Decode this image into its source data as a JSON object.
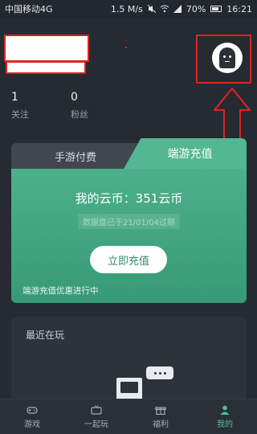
{
  "status_bar": {
    "carrier": "中国移动4G",
    "speed": "1.5 M/s",
    "battery": "70%",
    "time": "16:21"
  },
  "profile": {
    "stats": [
      {
        "value": "1",
        "label": "关注"
      },
      {
        "value": "0",
        "label": "粉丝"
      }
    ]
  },
  "recharge_card": {
    "tab_mobile": "手游付费",
    "tab_client": "端游充值",
    "coins_text": "我的云币：351云币",
    "expiry_text": "数据盘已于21/01/04过期",
    "recharge_button": "立即充值",
    "promo_text": "端游充值优惠进行中"
  },
  "recent": {
    "title": "最近在玩"
  },
  "bottom_nav": [
    {
      "label": "游戏",
      "icon": "gamepad-icon"
    },
    {
      "label": "一起玩",
      "icon": "tv-icon"
    },
    {
      "label": "福利",
      "icon": "gift-icon"
    },
    {
      "label": "我的",
      "icon": "person-icon"
    }
  ],
  "colors": {
    "background": "#262a31",
    "accent_green": "#52c08f",
    "annotation_red": "#e02323"
  }
}
